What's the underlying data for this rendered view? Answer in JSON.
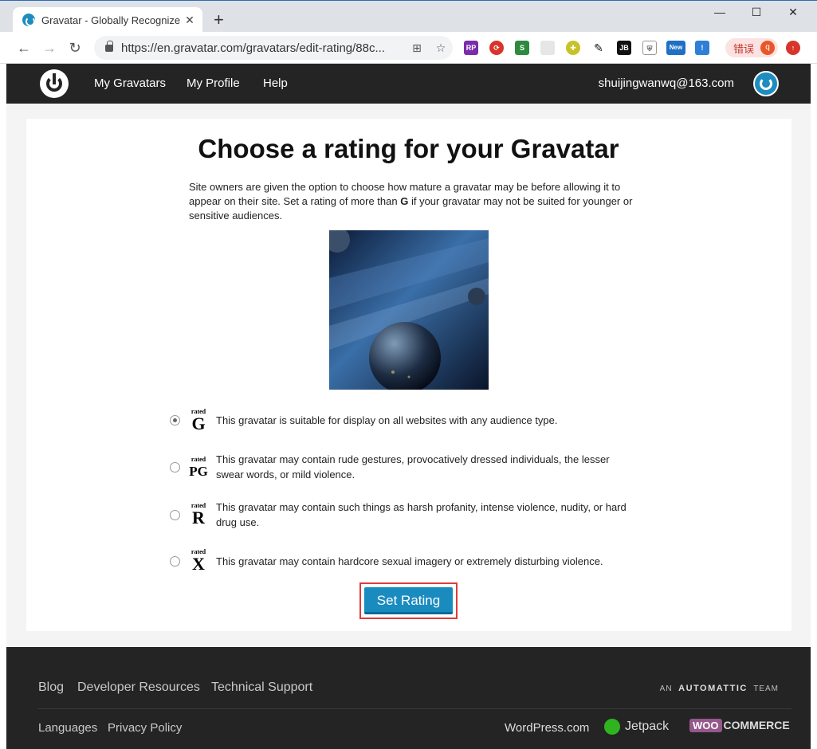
{
  "browser": {
    "tab_title": "Gravatar - Globally Recognize",
    "tab_close": "✕",
    "new_tab": "+",
    "url": "https://en.gravatar.com/gravatars/edit-rating/88c...",
    "window_minimize": "—",
    "window_maximize": "☐",
    "window_close": "✕",
    "error_label": "错误",
    "profile_initial": "q"
  },
  "header": {
    "nav": [
      "My Gravatars",
      "My Profile",
      "Help"
    ],
    "email": "shuijingwanwq@163.com"
  },
  "main": {
    "title": "Choose a rating for your Gravatar",
    "intro_before": "Site owners are given the option to choose how mature a gravatar may be before allowing it to appear on their site. Set a rating of more than ",
    "intro_bold": "G",
    "intro_after": " if your gravatar may not be suited for younger or sensitive audiences.",
    "ratings": [
      {
        "letter": "G",
        "rated": "rated",
        "description": "This gravatar is suitable for display on all websites with any audience type.",
        "checked": true
      },
      {
        "letter": "PG",
        "rated": "rated",
        "description": "This gravatar may contain rude gestures, provocatively dressed individuals, the lesser swear words, or mild violence.",
        "checked": false
      },
      {
        "letter": "R",
        "rated": "rated",
        "description": "This gravatar may contain such things as harsh profanity, intense violence, nudity, or hard drug use.",
        "checked": false
      },
      {
        "letter": "X",
        "rated": "rated",
        "description": "This gravatar may contain hardcore sexual imagery or extremely disturbing violence.",
        "checked": false
      }
    ],
    "set_rating_label": "Set Rating"
  },
  "footer": {
    "top_links": [
      "Blog",
      "Developer Resources",
      "Technical Support"
    ],
    "bottom_links": [
      "Languages",
      "Privacy Policy"
    ],
    "automattic_an": "AN",
    "automattic_name": "AUTOMATTIC",
    "automattic_team": "TEAM",
    "wordpress": "WordPress.com",
    "jetpack": "Jetpack",
    "woo_prefix": "WOO",
    "woo_suffix": "COMMERCE"
  },
  "colors": {
    "accent": "#1a8bbf",
    "header_bg": "#242424",
    "highlight_border": "#e03a3a"
  }
}
